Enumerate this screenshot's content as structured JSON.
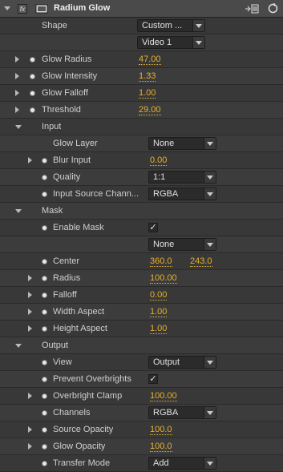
{
  "header": {
    "title": "Radium Glow",
    "fx_label": "fx"
  },
  "rows": [
    {
      "label": "Shape",
      "type": "dropdown",
      "value": "Custom ...",
      "indent": 52
    },
    {
      "label": "",
      "type": "dropdown",
      "value": "Video 1",
      "indent": 52
    },
    {
      "label": "Glow Radius",
      "type": "value",
      "value": "47.00",
      "expand": true,
      "stopwatch": true,
      "indent": 52
    },
    {
      "label": "Glow Intensity",
      "type": "value",
      "value": "1.33",
      "expand": true,
      "stopwatch": true,
      "indent": 52
    },
    {
      "label": "Glow Falloff",
      "type": "value",
      "value": "1.00",
      "expand": true,
      "stopwatch": true,
      "indent": 52
    },
    {
      "label": "Threshold",
      "type": "value",
      "value": "29.00",
      "expand": true,
      "stopwatch": true,
      "indent": 52
    },
    {
      "label": "Input",
      "type": "group",
      "indent": 52
    },
    {
      "label": "Glow Layer",
      "type": "dropdown",
      "value": "None",
      "indent": 66
    },
    {
      "label": "Blur Input",
      "type": "value",
      "value": "0.00",
      "expand": true,
      "stopwatch": true,
      "indent": 66
    },
    {
      "label": "Quality",
      "type": "dropdown",
      "value": "1:1",
      "stopwatch": true,
      "indent": 66
    },
    {
      "label": "Input Source Chann...",
      "type": "dropdown",
      "value": "RGBA",
      "stopwatch": true,
      "indent": 66
    },
    {
      "label": "Mask",
      "type": "group",
      "indent": 52
    },
    {
      "label": "Enable Mask",
      "type": "checkbox",
      "value": "✓",
      "stopwatch": true,
      "indent": 66
    },
    {
      "label": "",
      "type": "dropdown",
      "value": "None",
      "indent": 66
    },
    {
      "label": "Center",
      "type": "point",
      "value": "360.0",
      "value2": "243.0",
      "stopwatch": true,
      "indent": 66
    },
    {
      "label": "Radius",
      "type": "value",
      "value": "100.00",
      "expand": true,
      "stopwatch": true,
      "indent": 66
    },
    {
      "label": "Falloff",
      "type": "value",
      "value": "0.00",
      "expand": true,
      "stopwatch": true,
      "indent": 66
    },
    {
      "label": "Width Aspect",
      "type": "value",
      "value": "1.00",
      "expand": true,
      "stopwatch": true,
      "indent": 66
    },
    {
      "label": "Height Aspect",
      "type": "value",
      "value": "1.00",
      "expand": true,
      "stopwatch": true,
      "indent": 66
    },
    {
      "label": "Output",
      "type": "group",
      "indent": 52
    },
    {
      "label": "View",
      "type": "dropdown",
      "value": "Output",
      "stopwatch": true,
      "indent": 66
    },
    {
      "label": "Prevent Overbrights",
      "type": "checkbox",
      "value": "✓",
      "stopwatch": true,
      "indent": 66
    },
    {
      "label": "Overbright Clamp",
      "type": "value",
      "value": "100.00",
      "expand": true,
      "stopwatch": true,
      "indent": 66
    },
    {
      "label": "Channels",
      "type": "dropdown",
      "value": "RGBA",
      "stopwatch": true,
      "indent": 66
    },
    {
      "label": "Source Opacity",
      "type": "value",
      "value": "100.0",
      "expand": true,
      "stopwatch": true,
      "indent": 66
    },
    {
      "label": "Glow Opacity",
      "type": "value",
      "value": "100.0",
      "expand": true,
      "stopwatch": true,
      "indent": 66
    },
    {
      "label": "Transfer Mode",
      "type": "dropdown",
      "value": "Add",
      "stopwatch": true,
      "indent": 66
    }
  ],
  "colors": {
    "value_orange": "#e8b12c",
    "header_bg": "#4a4a4a",
    "panel_bg": "#383838"
  }
}
